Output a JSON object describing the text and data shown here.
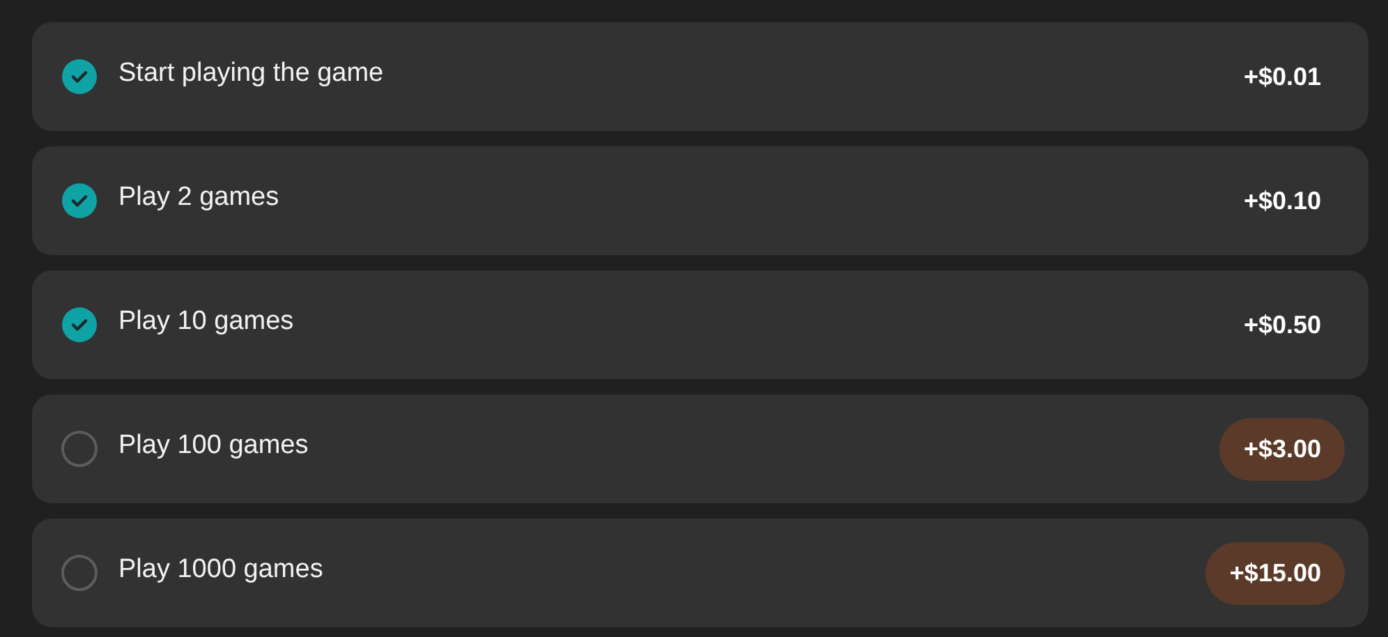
{
  "tasks": [
    {
      "label": "Start playing the game",
      "reward": "+$0.01",
      "checked": true
    },
    {
      "label": "Play 2 games",
      "reward": "+$0.10",
      "checked": true
    },
    {
      "label": "Play 10 games",
      "reward": "+$0.50",
      "checked": true
    },
    {
      "label": "Play 100 games",
      "reward": "+$3.00",
      "checked": false
    },
    {
      "label": "Play 1000 games",
      "reward": "+$15.00",
      "checked": false
    }
  ]
}
